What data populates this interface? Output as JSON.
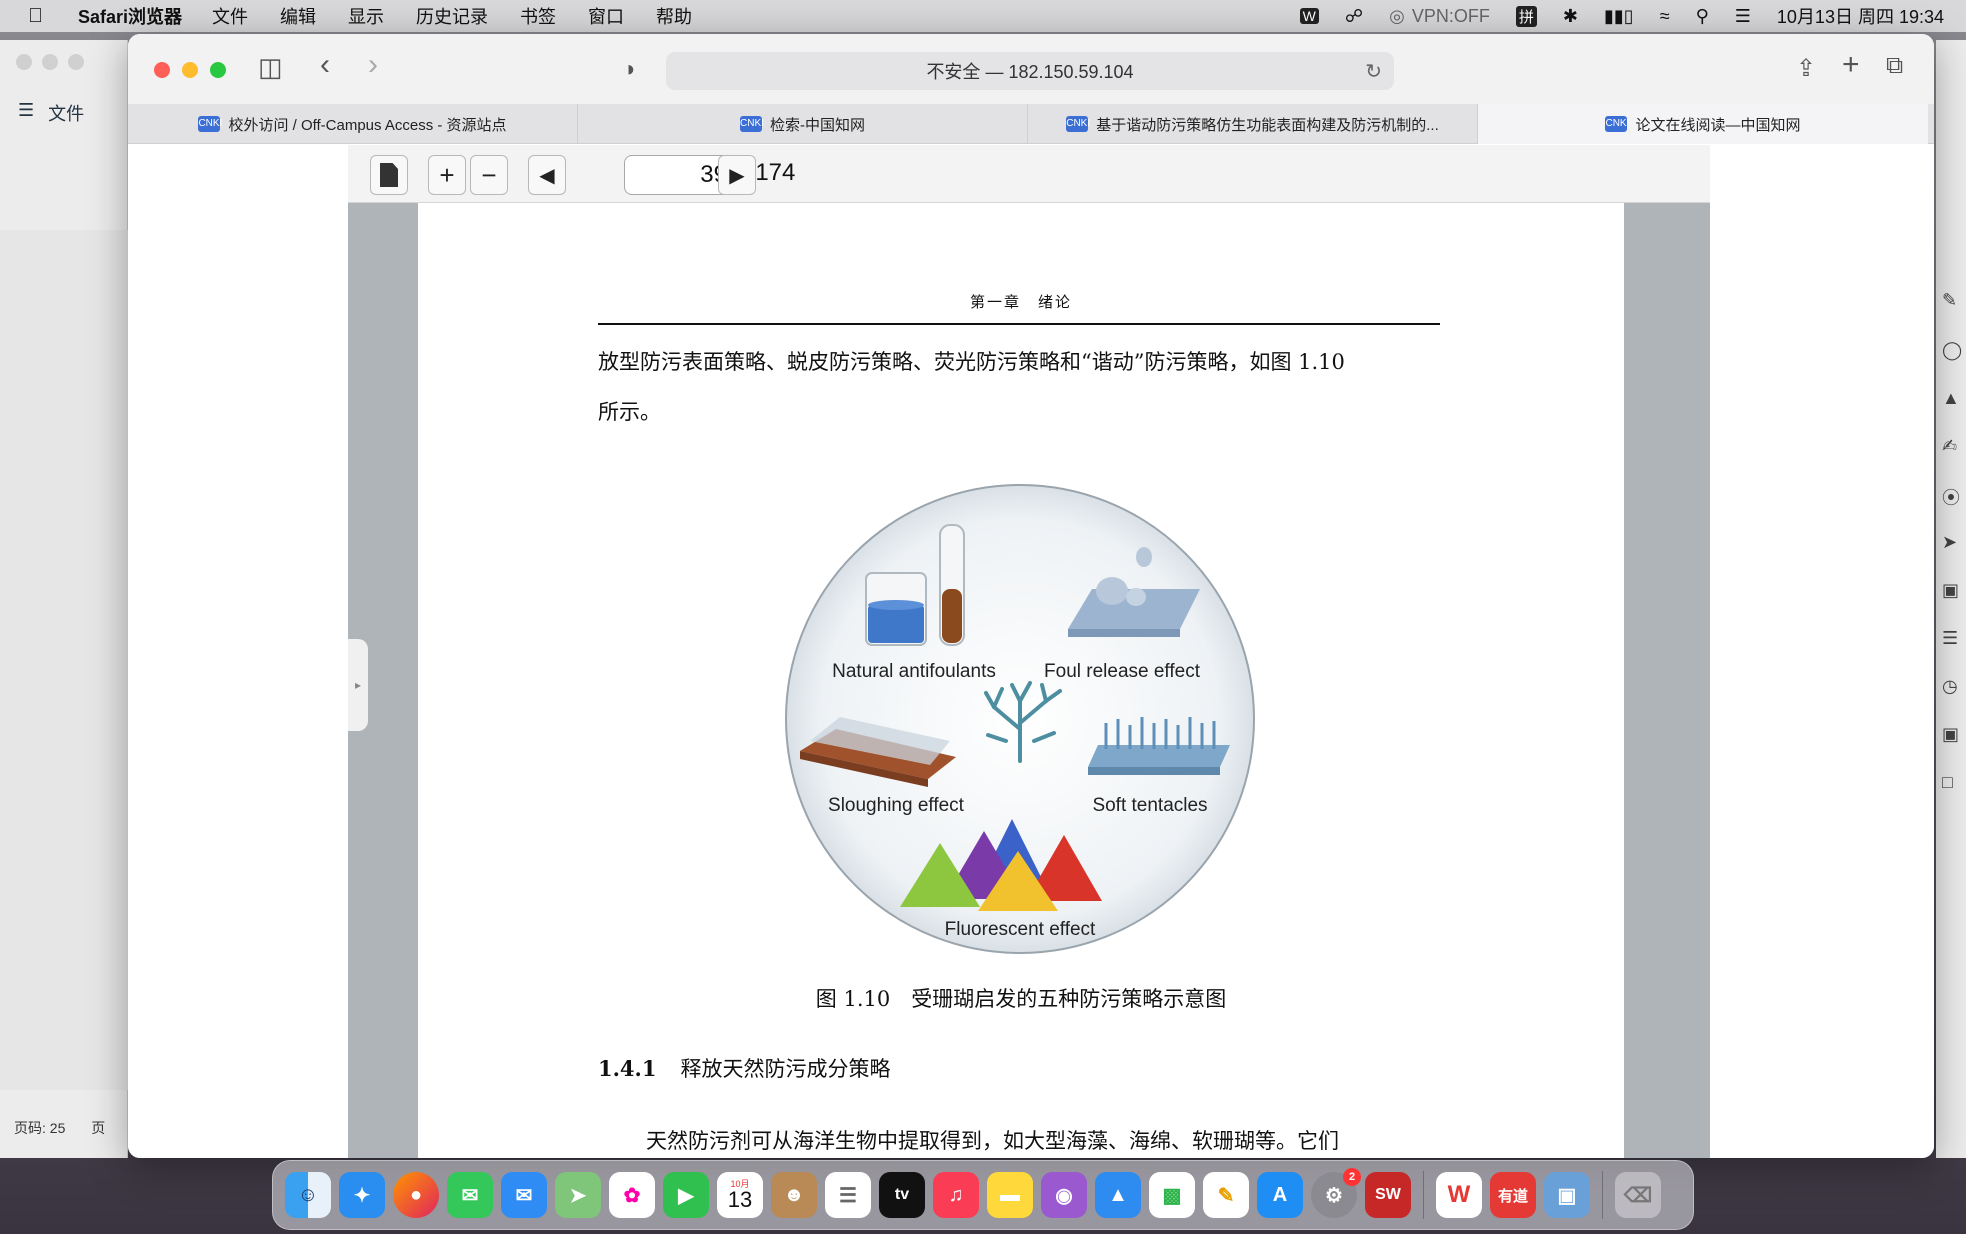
{
  "menubar": {
    "app_name": "Safari浏览器",
    "items": [
      "文件",
      "编辑",
      "显示",
      "历史记录",
      "书签",
      "窗口",
      "帮助"
    ],
    "status": {
      "vpn": "VPN:OFF",
      "ime": "拼",
      "datetime": "10月13日 周四  19:34"
    }
  },
  "background_window": {
    "file_label": "文件",
    "page_count_label": "页码: 25",
    "page_label_cut": "页"
  },
  "safari": {
    "address": "不安全 — 182.150.59.104",
    "tabs": [
      {
        "label": "校外访问 / Off-Campus Access - 资源站点",
        "active": false
      },
      {
        "label": "检索-中国知网",
        "active": false
      },
      {
        "label": "基于谐动防污策略仿生功能表面构建及防污机制的...",
        "active": false
      },
      {
        "label": "论文在线阅读—中国知网",
        "active": true
      }
    ],
    "favicon_text": "CNKI"
  },
  "pdf_viewer": {
    "current_page": "39",
    "total_pages": "/ 174",
    "page": {
      "running_head": "第一章　绪论",
      "body_line1": "放型防污表面策略、蜕皮防污策略、荧光防污策略和“谐动”防污策略，如图 1.10",
      "body_line2": "所示。",
      "figure_labels": {
        "natural": "Natural antifoulants",
        "foul_release": "Foul release effect",
        "sloughing": "Sloughing effect",
        "soft": "Soft tentacles",
        "fluorescent": "Fluorescent  effect"
      },
      "caption": "图 1.10　受珊瑚启发的五种防污策略示意图",
      "section_number": "1.4.1",
      "section_title": "释放天然防污成分策略",
      "next_paragraph": "天然防污剂可从海洋生物中提取得到，如大型海藻、海绵、软珊瑚等。它们"
    }
  },
  "dock": {
    "calendar_month": "10月",
    "calendar_day": "13",
    "tv_label": "tv",
    "wps_label": "W",
    "youdao_label": "有道",
    "sw_label": "SW",
    "settings_badge": "2"
  }
}
